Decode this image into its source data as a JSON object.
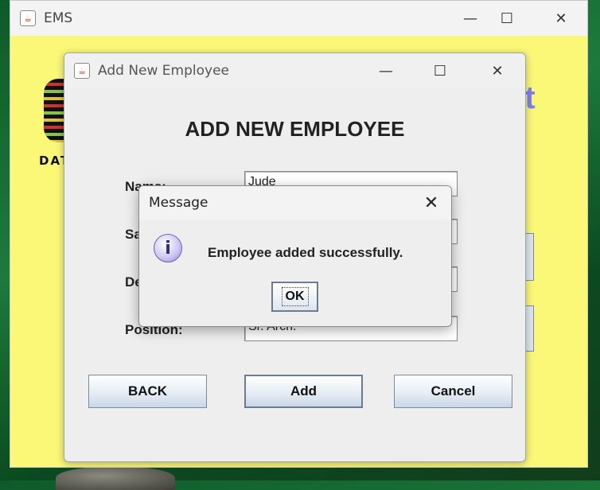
{
  "main_window": {
    "title": "EMS",
    "logo_text": "DAT",
    "heading_fragment": "nt",
    "icon": "java-icon"
  },
  "add_dialog": {
    "title": "Add New Employee",
    "heading": "ADD NEW EMPLOYEE",
    "fields": [
      {
        "label": "Name:",
        "value": "Jude"
      },
      {
        "label": "Sa",
        "value": ""
      },
      {
        "label": "De",
        "value": ""
      },
      {
        "label": "Position:",
        "value": "Sr. Arch."
      }
    ],
    "buttons": {
      "back": "BACK",
      "add": "Add",
      "cancel": "Cancel"
    }
  },
  "message_dialog": {
    "title": "Message",
    "text": "Employee added successfully.",
    "ok_label": "OK",
    "icon": "info-icon",
    "icon_glyph": "i"
  },
  "window_controls": {
    "minimize": "—",
    "maximize": "☐",
    "close": "✕",
    "dialog_close": "✕"
  },
  "java_glyph": "☕",
  "colors": {
    "ems_background": "#fbf877",
    "accent_text": "#8080f0"
  }
}
